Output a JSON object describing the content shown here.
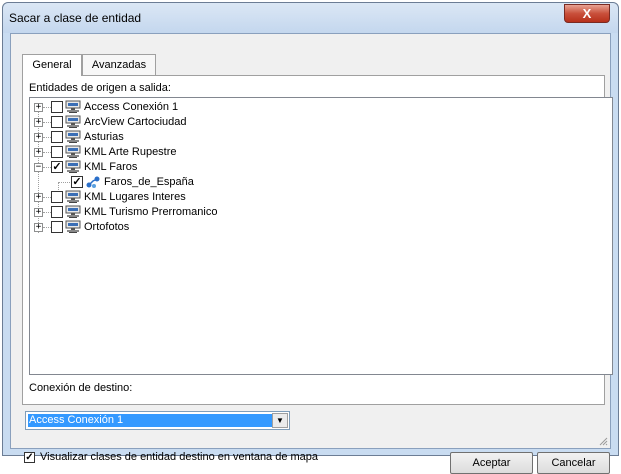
{
  "window": {
    "title": "Sacar a clase de entidad",
    "close_label": "X"
  },
  "tabs": [
    {
      "label": "General",
      "active": true
    },
    {
      "label": "Avanzadas",
      "active": false
    }
  ],
  "source": {
    "label": "Entidades de origen a salida:",
    "items": [
      {
        "label": "Access Conexión 1",
        "checked": false,
        "expanded": false
      },
      {
        "label": "ArcView Cartociudad",
        "checked": false,
        "expanded": false
      },
      {
        "label": "Asturias",
        "checked": false,
        "expanded": false
      },
      {
        "label": "KML Arte Rupestre",
        "checked": false,
        "expanded": false
      },
      {
        "label": "KML Faros",
        "checked": true,
        "expanded": true
      },
      {
        "label": "Faros_de_España",
        "checked": true,
        "child": true
      },
      {
        "label": "KML Lugares Interes",
        "checked": false,
        "expanded": false
      },
      {
        "label": "KML Turismo Prerromanico",
        "checked": false,
        "expanded": false
      },
      {
        "label": "Ortofotos",
        "checked": false,
        "expanded": false
      }
    ]
  },
  "destination": {
    "label": "Conexión de destino:",
    "selected": "Access Conexión 1"
  },
  "options": {
    "show_in_map_label": "Visualizar clases de entidad destino en ventana de mapa",
    "show_in_map_checked": true
  },
  "buttons": {
    "accept": "Aceptar",
    "cancel": "Cancelar"
  },
  "glyphs": {
    "plus": "+",
    "minus": "−",
    "check": "✓",
    "dropdown": "▼"
  }
}
